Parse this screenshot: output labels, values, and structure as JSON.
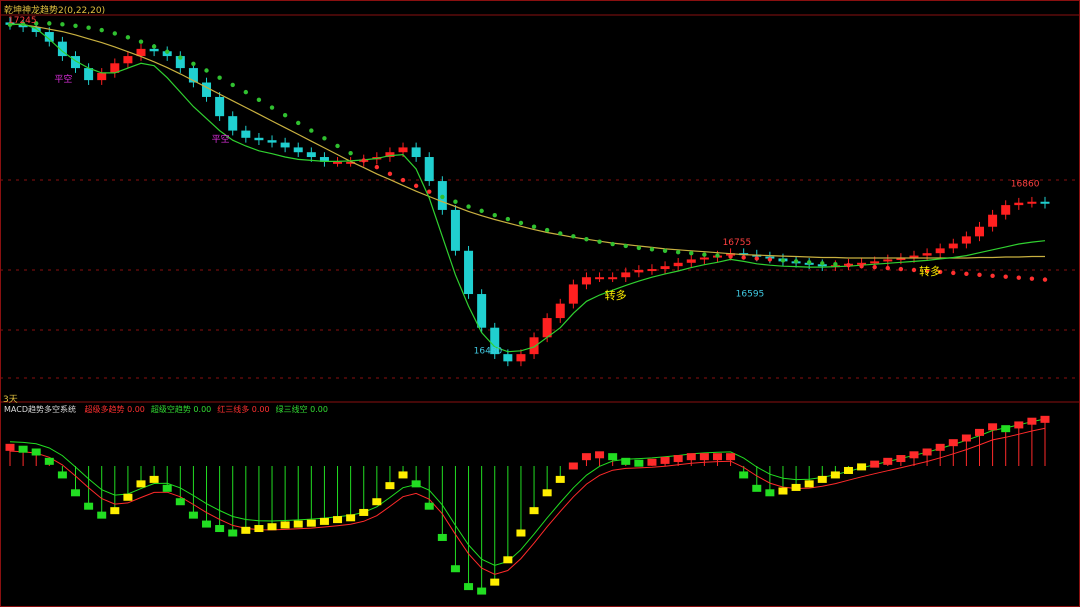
{
  "header": {
    "indicator_title": "乾坤神龙趋势2(0,22,20)"
  },
  "period_label": "3天",
  "macd_panel": {
    "name": "MACD趋势多空系统",
    "legend": [
      {
        "label": "超级多趋势",
        "value": "0.00",
        "color": "#ff3030"
      },
      {
        "label": "超级空趋势",
        "value": "0.00",
        "color": "#33dd33"
      },
      {
        "label": "红三线多",
        "value": "0.00",
        "color": "#ff3030"
      },
      {
        "label": "绿三线空",
        "value": "0.00",
        "color": "#33dd33"
      }
    ]
  },
  "colors": {
    "bg": "#000000",
    "up_candle": "#ff2020",
    "down_candle": "#20d0d0",
    "ma_green": "#30d030",
    "ma_yellow": "#c8b040",
    "dot_green": "#30c030",
    "dot_red": "#ff3030",
    "grid_red": "#8a1010",
    "macd_green": "#22dd22",
    "macd_red": "#ff2a2a",
    "macd_yellow": "#ffee00"
  },
  "chart_data": {
    "type": "candlestick",
    "price_labels": [
      {
        "text": "17245",
        "kind": "high"
      },
      {
        "text": "16860",
        "kind": "high"
      },
      {
        "text": "16595",
        "kind": "low"
      },
      {
        "text": "16480",
        "kind": "low"
      },
      {
        "text": "16755",
        "kind": "high"
      }
    ],
    "signals": [
      {
        "text": "平空",
        "kind": "short",
        "index": 4
      },
      {
        "text": "平空",
        "kind": "short",
        "index": 16
      },
      {
        "text": "转多",
        "kind": "long",
        "index": 46
      },
      {
        "text": "转多",
        "kind": "long",
        "index": 70
      }
    ],
    "closes": [
      17230,
      17225,
      17215,
      17195,
      17165,
      17140,
      17115,
      17130,
      17150,
      17165,
      17180,
      17175,
      17165,
      17140,
      17110,
      17080,
      17040,
      17010,
      16995,
      16990,
      16985,
      16975,
      16965,
      16955,
      16945,
      16945,
      16945,
      16950,
      16955,
      16965,
      16975,
      16955,
      16905,
      16845,
      16760,
      16670,
      16600,
      16545,
      16530,
      16545,
      16580,
      16620,
      16650,
      16690,
      16705,
      16705,
      16705,
      16715,
      16720,
      16722,
      16728,
      16735,
      16742,
      16746,
      16750,
      16755,
      16752,
      16748,
      16744,
      16738,
      16735,
      16732,
      16728,
      16730,
      16733,
      16735,
      16738,
      16742,
      16745,
      16750,
      16755,
      16765,
      16775,
      16790,
      16810,
      16835,
      16855,
      16860,
      16862,
      16858
    ],
    "ma_green": [
      17230,
      17232,
      17222,
      17200,
      17175,
      17155,
      17140,
      17130,
      17130,
      17140,
      17150,
      17145,
      17120,
      17090,
      17060,
      17035,
      17010,
      16990,
      16978,
      16968,
      16962,
      16955,
      16950,
      16948,
      16946,
      16946,
      16947,
      16949,
      16952,
      16958,
      16960,
      16930,
      16870,
      16790,
      16710,
      16645,
      16590,
      16560,
      16550,
      16552,
      16560,
      16580,
      16600,
      16630,
      16655,
      16668,
      16678,
      16688,
      16697,
      16705,
      16712,
      16718,
      16725,
      16731,
      16736,
      16742,
      16738,
      16733,
      16730,
      16728,
      16727,
      16726,
      16726,
      16727,
      16728,
      16730,
      16732,
      16734,
      16736,
      16738,
      16740,
      16743,
      16746,
      16750,
      16756,
      16762,
      16768,
      16774,
      16778,
      16781
    ],
    "ma_yellow": [
      17232,
      17230,
      17226,
      17221,
      17216,
      17209,
      17201,
      17193,
      17184,
      17174,
      17164,
      17153,
      17141,
      17128,
      17114,
      17100,
      17086,
      17072,
      17058,
      17044,
      17030,
      17016,
      17002,
      16988,
      16974,
      16960,
      16946,
      16933,
      16920,
      16908,
      16896,
      16884,
      16873,
      16862,
      16852,
      16842,
      16833,
      16825,
      16818,
      16811,
      16804,
      16798,
      16793,
      16788,
      16784,
      16780,
      16776,
      16773,
      16770,
      16767,
      16764,
      16762,
      16760,
      16758,
      16756,
      16754,
      16752,
      16751,
      16750,
      16749,
      16748,
      16747,
      16746,
      16746,
      16745,
      16745,
      16745,
      16745,
      16745,
      16745,
      16745,
      16745,
      16745,
      16745,
      16746,
      16746,
      16747,
      16747,
      16748,
      16748
    ],
    "dots_line": [
      17230,
      17232,
      17233,
      17233,
      17231,
      17228,
      17224,
      17219,
      17212,
      17204,
      17195,
      17185,
      17174,
      17162,
      17149,
      17135,
      17120,
      17105,
      17090,
      17074,
      17058,
      17042,
      17026,
      17010,
      16994,
      16978,
      16963,
      16948,
      16934,
      16920,
      16907,
      16895,
      16883,
      16872,
      16862,
      16852,
      16843,
      16834,
      16826,
      16818,
      16810,
      16803,
      16796,
      16790,
      16784,
      16779,
      16774,
      16770,
      16766,
      16763,
      16760,
      16757,
      16755,
      16752,
      16750,
      16748,
      16746,
      16744,
      16742,
      16740,
      16738,
      16736,
      16734,
      16732,
      16730,
      16728,
      16726,
      16724,
      16722,
      16720,
      16718,
      16716,
      16714,
      16712,
      16710,
      16708,
      16706,
      16704,
      16702,
      16700
    ],
    "macd": [
      20,
      18,
      15,
      5,
      -10,
      -30,
      -45,
      -55,
      -50,
      -35,
      -20,
      -15,
      -25,
      -40,
      -55,
      -65,
      -70,
      -75,
      -72,
      -70,
      -68,
      -66,
      -65,
      -64,
      -62,
      -60,
      -58,
      -52,
      -40,
      -22,
      -10,
      -20,
      -45,
      -80,
      -115,
      -135,
      -140,
      -130,
      -105,
      -75,
      -50,
      -30,
      -15,
      0,
      10,
      12,
      10,
      5,
      3,
      4,
      6,
      8,
      10,
      10,
      10,
      10,
      -10,
      -25,
      -30,
      -28,
      -24,
      -20,
      -15,
      -10,
      -5,
      -1,
      2,
      5,
      8,
      12,
      15,
      20,
      25,
      30,
      36,
      42,
      40,
      44,
      48,
      50
    ],
    "y_range": [
      16460,
      17265
    ],
    "macd_range": [
      -150,
      60
    ]
  }
}
